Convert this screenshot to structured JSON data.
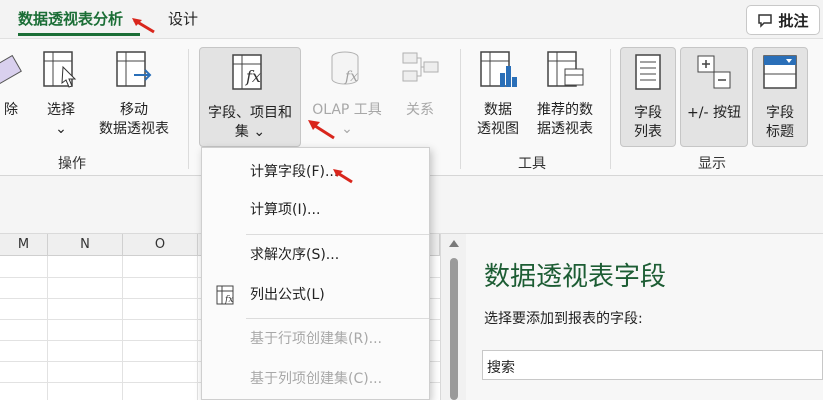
{
  "tabs": [
    {
      "label": "数据透视表分析",
      "active": true
    },
    {
      "label": "设计",
      "active": false
    }
  ],
  "comment_button": {
    "label": "批注",
    "icon": "comment-icon"
  },
  "ribbon": {
    "groups": {
      "operate": "操作",
      "tools": "工具",
      "show": "显示"
    },
    "buttons": {
      "delete": "除",
      "select": {
        "line1": "选择",
        "line2": "⌄"
      },
      "move": {
        "line1": "移动",
        "line2": "数据透视表"
      },
      "fields_items": {
        "line1": "字段、项目和",
        "line2": "集 ⌄"
      },
      "olap": {
        "line1": "OLAP 工具",
        "line2": "⌄"
      },
      "relations": "关系",
      "pivot_chart": {
        "line1": "数据",
        "line2": "透视图"
      },
      "recommended": {
        "line1": "推荐的数",
        "line2": "据透视表"
      },
      "field_list": {
        "line1": "字段",
        "line2": "列表"
      },
      "plus_minus": {
        "line1": "+/- 按钮"
      },
      "field_headers": {
        "line1": "字段",
        "line2": "标题"
      }
    }
  },
  "columns": [
    "M",
    "N",
    "O"
  ],
  "menu": {
    "items": [
      {
        "label": "计算字段(F)...",
        "disabled": false
      },
      {
        "label": "计算项(I)...",
        "disabled": false
      },
      {
        "label": "求解次序(S)...",
        "disabled": false
      },
      {
        "label": "列出公式(L)",
        "disabled": false
      },
      {
        "label": "基于行项创建集(R)...",
        "disabled": true
      },
      {
        "label": "基于列项创建集(C)...",
        "disabled": true
      }
    ]
  },
  "field_panel": {
    "title": "数据透视表字段",
    "subtitle": "选择要添加到报表的字段:",
    "search_value": "搜索"
  },
  "colors": {
    "accent_green": "#1b6e36",
    "annotation_red": "#d9261c"
  }
}
